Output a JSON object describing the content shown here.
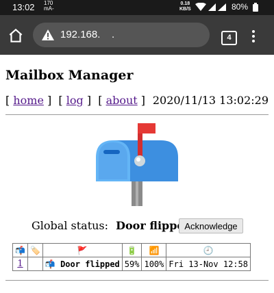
{
  "status_bar": {
    "time": "13:02",
    "net_line1": "170",
    "net_line2": "mA-",
    "speed_line1": "0.18",
    "speed_line2": "KB/S",
    "battery": "80%"
  },
  "browser": {
    "url": "192.168.    .",
    "tab_count": "4"
  },
  "page": {
    "title": "Mailbox Manager",
    "nav": {
      "home": "home",
      "log": "log",
      "about": "about"
    },
    "datetime": "2020/11/13 13:02:29",
    "global_status_label": "Global status:",
    "global_status_value": "Door flipped",
    "acknowledge_label": "Acknowledge"
  },
  "table": {
    "headers": [
      "📬",
      "🏷️",
      "🚩",
      "🔋",
      "📶",
      "🕘"
    ],
    "rows": [
      {
        "id": "1",
        "tag": "",
        "status": "📬 Door flipped",
        "battery": "59%",
        "signal": "100%",
        "time": "Fri 13-Nov 12:58"
      }
    ]
  },
  "colors": {
    "status_bar_bg": "#1a1a1a",
    "toolbar_bg": "#3a3a3a",
    "link": "#551a8b",
    "mailbox_blue": "#42a5f5",
    "flag_red": "#e53935"
  }
}
